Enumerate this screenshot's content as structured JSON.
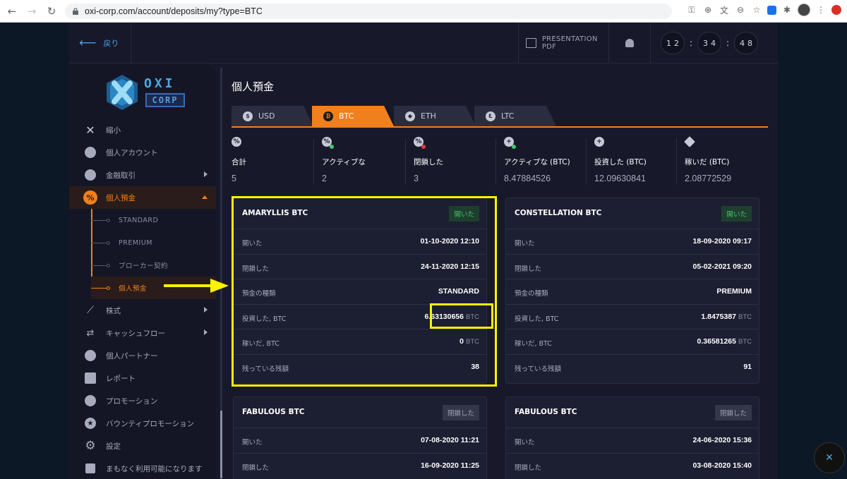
{
  "browser": {
    "url": "oxi-corp.com/account/deposits/my?type=BTC"
  },
  "topbar": {
    "back_label": "戻り",
    "presentation_label": "PRESENTATION PDF",
    "clock": [
      "12",
      "34",
      "48"
    ]
  },
  "logo": {
    "top": "OXI",
    "bottom": "CORP"
  },
  "sidebar": {
    "items": [
      {
        "label": "縮小",
        "icon": "close-icon"
      },
      {
        "label": "個人アカウント",
        "icon": "user-icon"
      },
      {
        "label": "金融取引",
        "icon": "exchange-icon"
      },
      {
        "label": "個人預金",
        "icon": "percent-icon"
      },
      {
        "label": "株式",
        "icon": "chart-icon"
      },
      {
        "label": "キャッシュフロー",
        "icon": "transfer-icon"
      },
      {
        "label": "個人パートナー",
        "icon": "partners-icon"
      },
      {
        "label": "レポート",
        "icon": "report-icon"
      },
      {
        "label": "プロモーション",
        "icon": "megaphone-icon"
      },
      {
        "label": "バウンティプロモーション",
        "icon": "star-icon"
      },
      {
        "label": "設定",
        "icon": "gear-icon"
      },
      {
        "label": "まもなく利用可能になります",
        "icon": "calendar-icon"
      }
    ],
    "sub_items": [
      "STANDARD",
      "PREMIUM",
      "ブローカー契約",
      "個人預金"
    ]
  },
  "main": {
    "title": "個人預金",
    "tabs": [
      {
        "label": "USD",
        "icon": "$"
      },
      {
        "label": "BTC",
        "icon": "₿"
      },
      {
        "label": "ETH",
        "icon": "◆"
      },
      {
        "label": "LTC",
        "icon": "Ł"
      }
    ],
    "stats": [
      {
        "label": "合計",
        "value": "5"
      },
      {
        "label": "アクティブな",
        "value": "2"
      },
      {
        "label": "閉鎖した",
        "value": "3"
      },
      {
        "label": "アクティブな (BTC)",
        "value": "8.47884526"
      },
      {
        "label": "投資した (BTC)",
        "value": "12.09630841"
      },
      {
        "label": "稼いだ (BTC)",
        "value": "2.08772529"
      }
    ],
    "cards": [
      {
        "title": "AMARYLLIS BTC",
        "badge": "開いた",
        "rows": [
          {
            "label": "開いた",
            "value": "01-10-2020 12:10",
            "unit": ""
          },
          {
            "label": "閉鎖した",
            "value": "24-11-2020 12:15",
            "unit": ""
          },
          {
            "label": "預金の種類",
            "value": "STANDARD",
            "unit": ""
          },
          {
            "label": "投資した, BTC",
            "value": "6.63130656",
            "unit": "BTC"
          },
          {
            "label": "稼いだ, BTC",
            "value": "0",
            "unit": "BTC"
          },
          {
            "label": "残っている残額",
            "value": "38",
            "unit": ""
          }
        ]
      },
      {
        "title": "CONSTELLATION BTC",
        "badge": "開いた",
        "rows": [
          {
            "label": "開いた",
            "value": "18-09-2020 09:17",
            "unit": ""
          },
          {
            "label": "閉鎖した",
            "value": "05-02-2021 09:20",
            "unit": ""
          },
          {
            "label": "預金の種類",
            "value": "PREMIUM",
            "unit": ""
          },
          {
            "label": "投資した, BTC",
            "value": "1.8475387",
            "unit": "BTC"
          },
          {
            "label": "稼いだ, BTC",
            "value": "0.36581265",
            "unit": "BTC"
          },
          {
            "label": "残っている残額",
            "value": "91",
            "unit": ""
          }
        ]
      },
      {
        "title": "FABULOUS BTC",
        "badge": "閉鎖した",
        "rows": [
          {
            "label": "開いた",
            "value": "07-08-2020 11:21",
            "unit": ""
          },
          {
            "label": "閉鎖した",
            "value": "16-09-2020 11:25",
            "unit": ""
          }
        ]
      },
      {
        "title": "FABULOUS BTC",
        "badge": "閉鎖した",
        "rows": [
          {
            "label": "開いた",
            "value": "24-06-2020 15:36",
            "unit": ""
          },
          {
            "label": "閉鎖した",
            "value": "03-08-2020 15:40",
            "unit": ""
          }
        ]
      }
    ]
  },
  "colors": {
    "accent": "#f0801e",
    "highlight": "#fff200",
    "open_badge": "#45c66b",
    "link": "#4d9de0"
  }
}
